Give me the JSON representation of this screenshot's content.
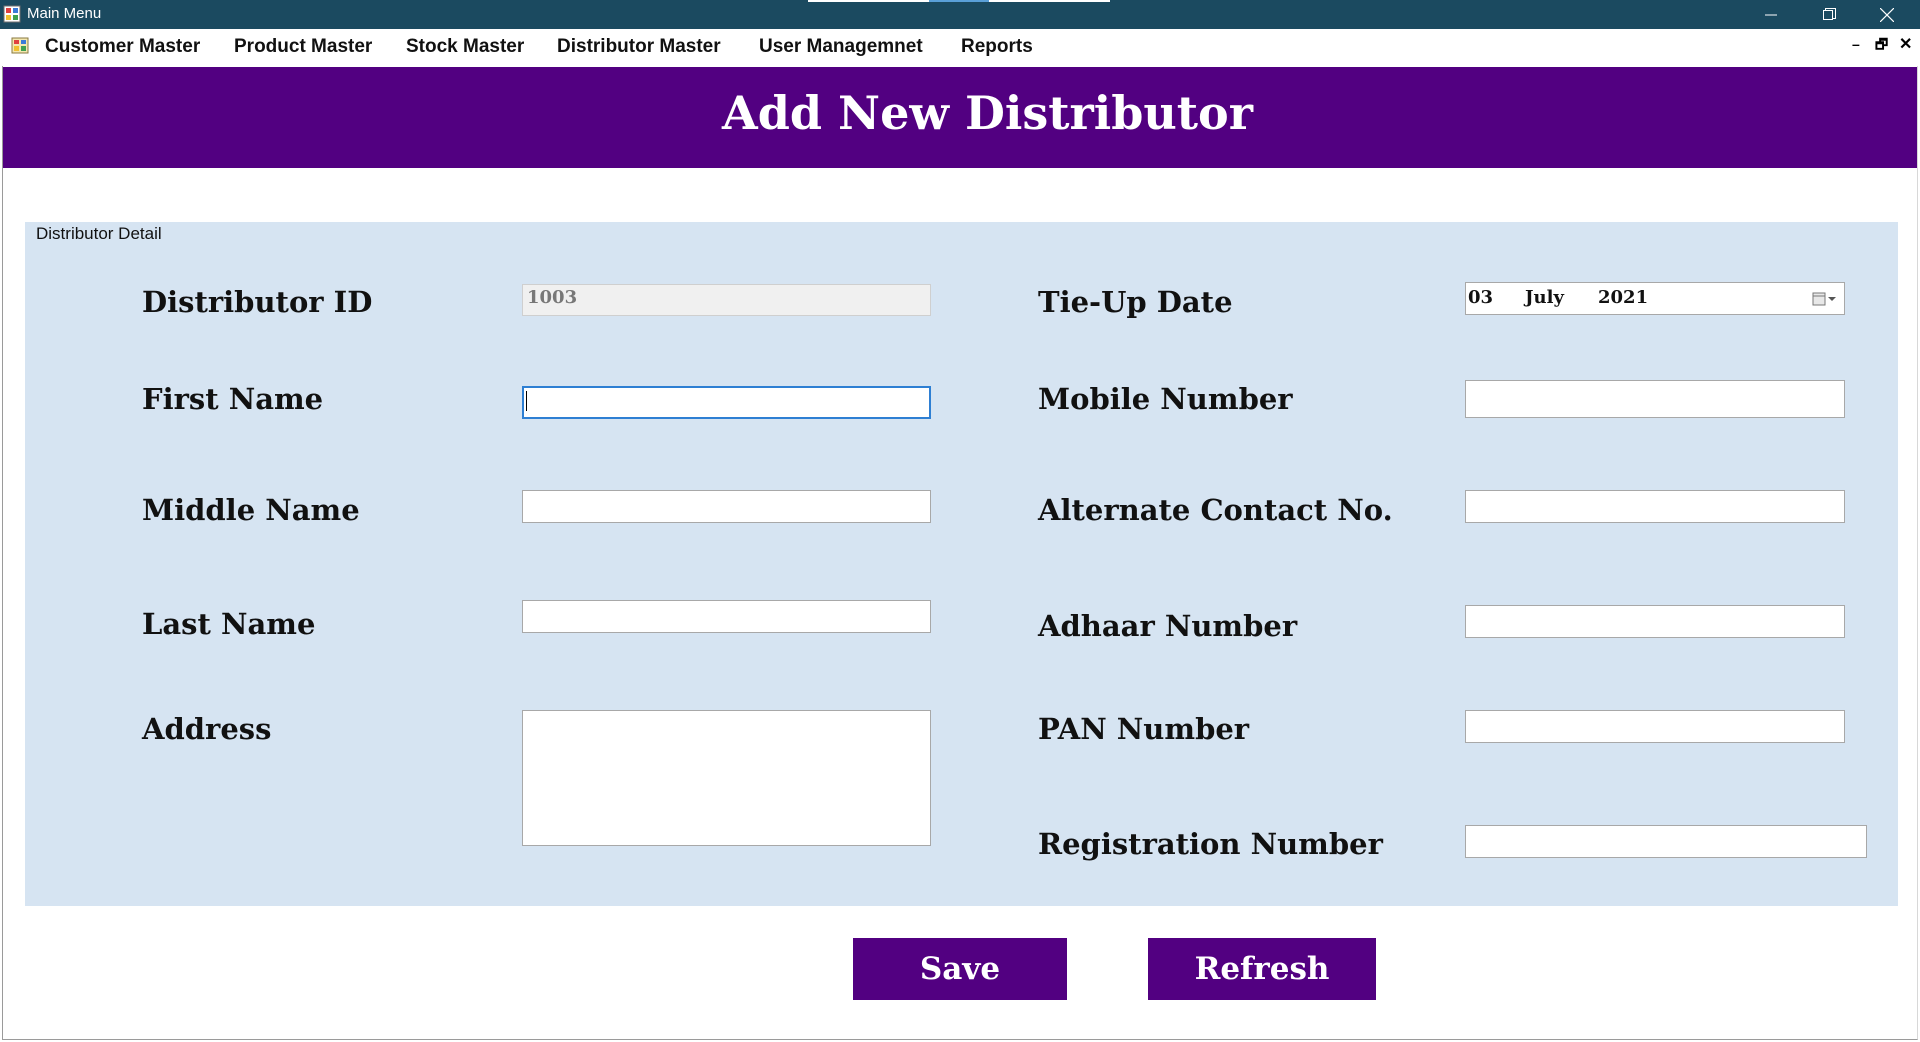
{
  "window": {
    "title": "Main Menu",
    "minimize_glyph": "–",
    "close_glyph": "✕"
  },
  "menu": {
    "items": [
      "Customer Master",
      "Product Master",
      "Stock Master",
      "Distributor Master",
      "User Managemnet",
      "Reports"
    ],
    "mdi_min": "–",
    "mdi_restore": "🗗",
    "mdi_close": "✕"
  },
  "header": {
    "title": "Add New Distributor",
    "background": "#520081"
  },
  "group": {
    "caption": "Distributor Detail",
    "background": "#d6e4f2"
  },
  "form": {
    "left": {
      "distributor_id_label": "Distributor ID",
      "distributor_id_value": "1003",
      "first_name_label": "First Name",
      "first_name_value": "",
      "middle_name_label": "Middle Name",
      "middle_name_value": "",
      "last_name_label": "Last Name",
      "last_name_value": "",
      "address_label": "Address",
      "address_value": ""
    },
    "right": {
      "tieup_date_label": "Tie-Up Date",
      "tieup_day": "03",
      "tieup_month": "July",
      "tieup_year": "2021",
      "mobile_label": "Mobile Number",
      "mobile_value": "",
      "alt_contact_label": "Alternate Contact No.",
      "alt_contact_value": "",
      "adhaar_label": "Adhaar Number",
      "adhaar_value": "",
      "pan_label": "PAN Number",
      "pan_value": "",
      "registration_label": "Registration Number",
      "registration_value": ""
    }
  },
  "buttons": {
    "save": "Save",
    "refresh": "Refresh"
  }
}
